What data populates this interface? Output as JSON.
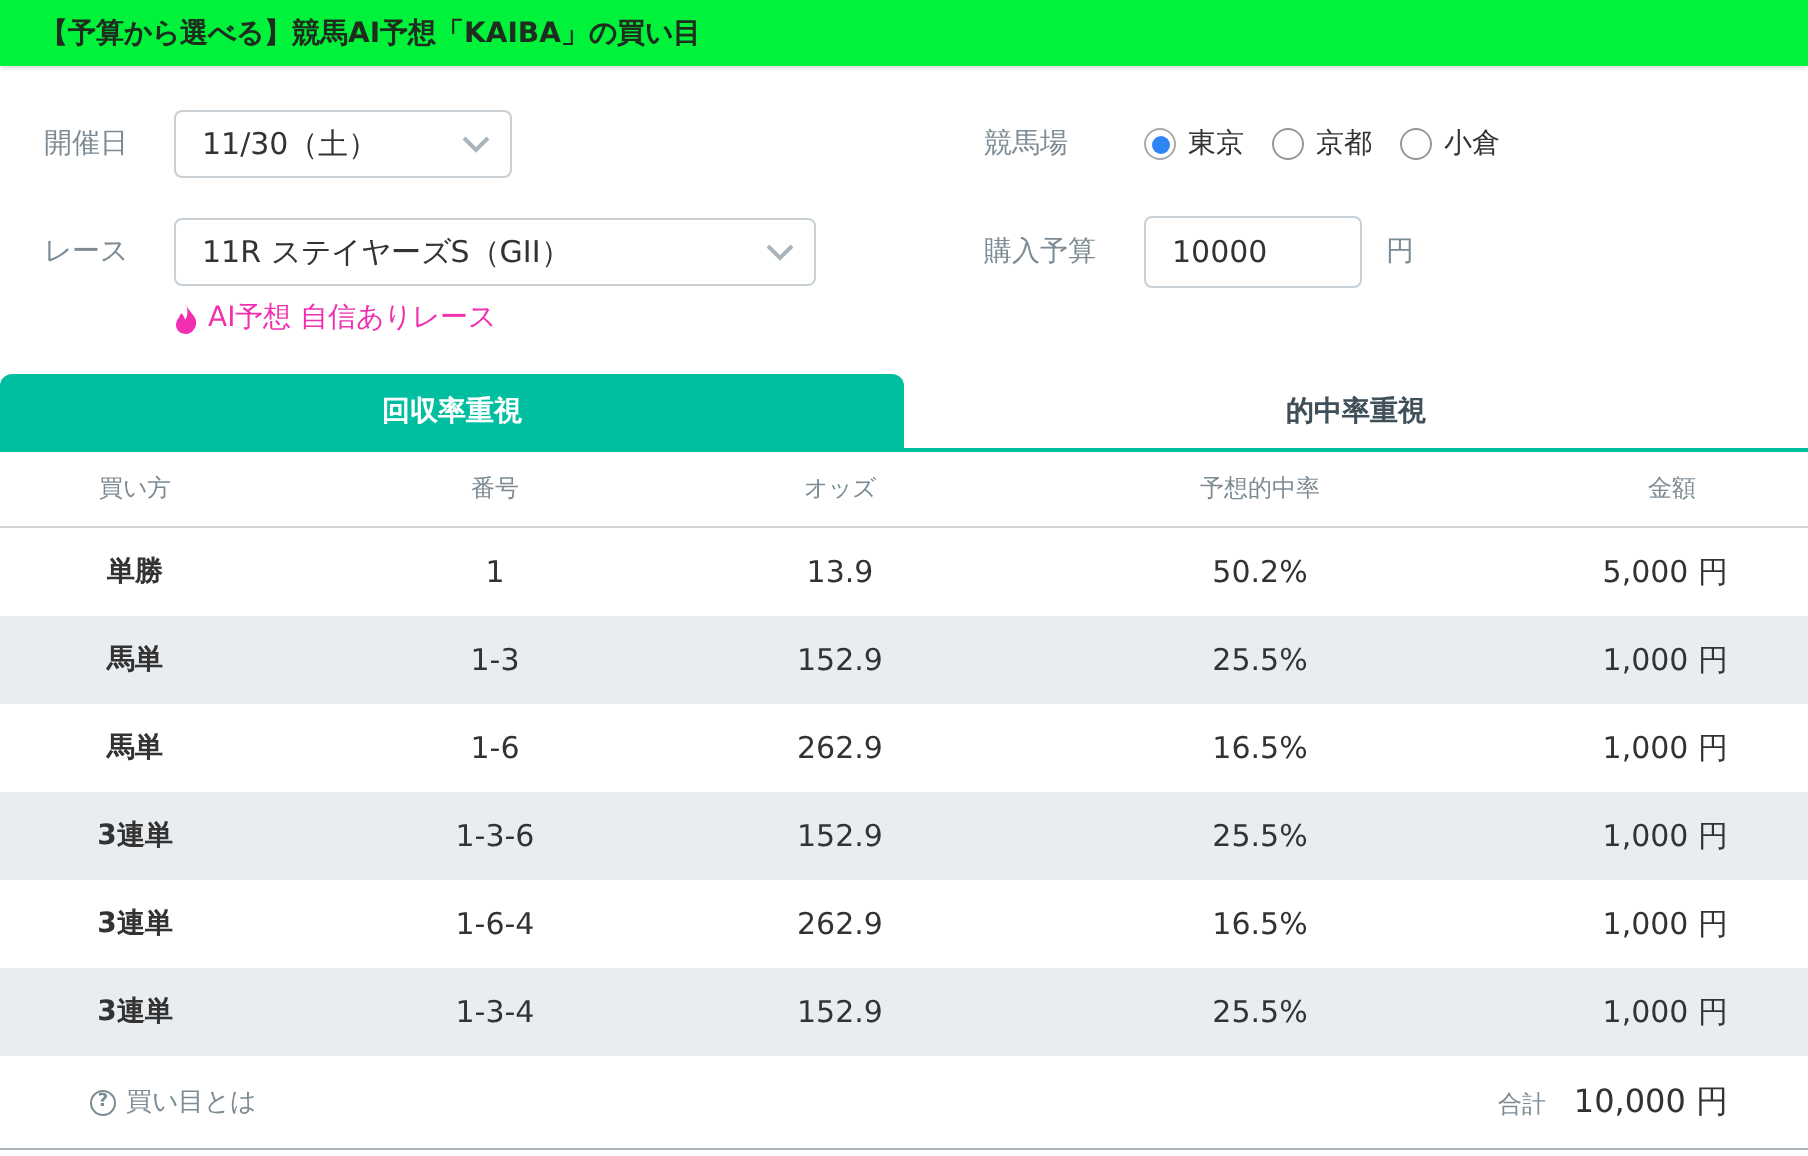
{
  "header": {
    "title": "【予算から選べる】競馬AI予想「KAIBA」の買い目"
  },
  "form": {
    "date_label": "開催日",
    "date_value": "11/30（土）",
    "race_label": "レース",
    "race_value": "11R ステイヤーズS（GII）",
    "confidence_note": "AI予想 自信ありレース",
    "venue_label": "競馬場",
    "venues": [
      {
        "label": "東京",
        "selected": true
      },
      {
        "label": "京都",
        "selected": false
      },
      {
        "label": "小倉",
        "selected": false
      }
    ],
    "budget_label": "購入予算",
    "budget_value": "10000",
    "budget_unit": "円"
  },
  "tabs": [
    {
      "label": "回収率重視",
      "selected": true
    },
    {
      "label": "的中率重視",
      "selected": false
    }
  ],
  "table": {
    "columns": [
      "買い方",
      "番号",
      "オッズ",
      "予想的中率",
      "金額"
    ],
    "rows": [
      [
        "単勝",
        "1",
        "13.9",
        "50.2%",
        "5,000 円"
      ],
      [
        "馬単",
        "1-3",
        "152.9",
        "25.5%",
        "1,000 円"
      ],
      [
        "馬単",
        "1-6",
        "262.9",
        "16.5%",
        "1,000 円"
      ],
      [
        "3連単",
        "1-3-6",
        "152.9",
        "25.5%",
        "1,000 円"
      ],
      [
        "3連単",
        "1-6-4",
        "262.9",
        "16.5%",
        "1,000 円"
      ],
      [
        "3連単",
        "1-3-4",
        "152.9",
        "25.5%",
        "1,000 円"
      ]
    ]
  },
  "footer": {
    "help_icon": "?",
    "help_link": "買い目とは",
    "total_label": "合計",
    "total_value": "10,000 円"
  }
}
